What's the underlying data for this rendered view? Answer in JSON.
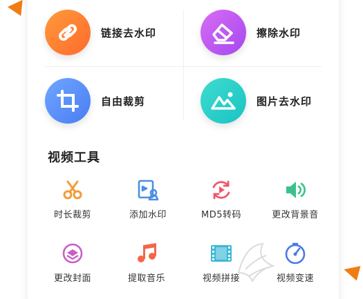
{
  "features": [
    {
      "label": "链接去水印",
      "icon": "link-icon",
      "gradient_from": "#ff9a3c",
      "gradient_to": "#ff6a2b"
    },
    {
      "label": "擦除水印",
      "icon": "eraser-icon",
      "gradient_from": "#d86cf5",
      "gradient_to": "#a548ee"
    },
    {
      "label": "自由裁剪",
      "icon": "crop-icon",
      "gradient_from": "#6fa6ff",
      "gradient_to": "#4a7df4"
    },
    {
      "label": "图片去水印",
      "icon": "image-icon",
      "gradient_from": "#3fdccf",
      "gradient_to": "#19c3c4"
    }
  ],
  "video_tools": {
    "title": "视频工具",
    "items": [
      {
        "label": "时长裁剪",
        "icon": "scissors-icon",
        "color": "#f29b38"
      },
      {
        "label": "添加水印",
        "icon": "watermark-icon",
        "color": "#4a90e2"
      },
      {
        "label": "MD5转码",
        "icon": "convert-icon",
        "color": "#f0556b"
      },
      {
        "label": "更改背景音",
        "icon": "speaker-icon",
        "color": "#3bc28a"
      },
      {
        "label": "更改封面",
        "icon": "cover-icon",
        "color": "#c95fc5"
      },
      {
        "label": "提取音乐",
        "icon": "music-icon",
        "color": "#f2674a"
      },
      {
        "label": "视频拼接",
        "icon": "film-icon",
        "color": "#3bb8d6"
      },
      {
        "label": "视频变速",
        "icon": "speed-icon",
        "color": "#4a78e8"
      }
    ]
  },
  "watermark_logo": "logo-watermark"
}
